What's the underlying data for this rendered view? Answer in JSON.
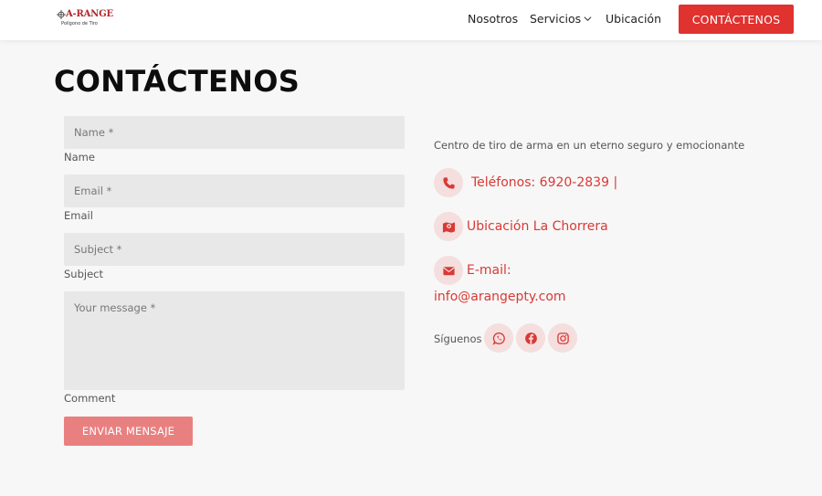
{
  "header": {
    "logo_brand": "A-RANGE",
    "logo_tagline": "Polígono de Tiro",
    "nav": {
      "nosotros": "Nosotros",
      "servicios": "Servicios",
      "ubicacion": "Ubicación"
    },
    "cta_label": "CONTÁCTENOS"
  },
  "page_title": "CONTÁCTENOS",
  "form": {
    "name": {
      "placeholder": "Name *",
      "value": "",
      "label": "Name"
    },
    "email": {
      "placeholder": "Email *",
      "value": "",
      "label": "Email"
    },
    "subject": {
      "placeholder": "Subject *",
      "value": "",
      "label": "Subject"
    },
    "message": {
      "placeholder": "Your message *",
      "value": "",
      "label": "Comment"
    },
    "submit_label": "ENVIAR MENSAJE"
  },
  "contact": {
    "intro": "Centro de tiro de arma en un eterno seguro y emocionante",
    "phone": "Teléfonos: 6920-2839 |",
    "location": "Ubicación La Chorrera",
    "email_label": "E-mail:",
    "email": "info@arangepty.com",
    "follow_label": "Síguenos"
  },
  "icons": {
    "phone": "phone-icon",
    "location": "map-marker-icon",
    "email": "envelope-icon",
    "whatsapp": "whatsapp-icon",
    "facebook": "facebook-icon",
    "instagram": "instagram-icon"
  },
  "colors": {
    "accent": "#e0322f",
    "link": "#d83a36",
    "icon_bg": "#f4dede",
    "submit_bg": "#e98080",
    "field_bg": "#e8e8e8"
  }
}
